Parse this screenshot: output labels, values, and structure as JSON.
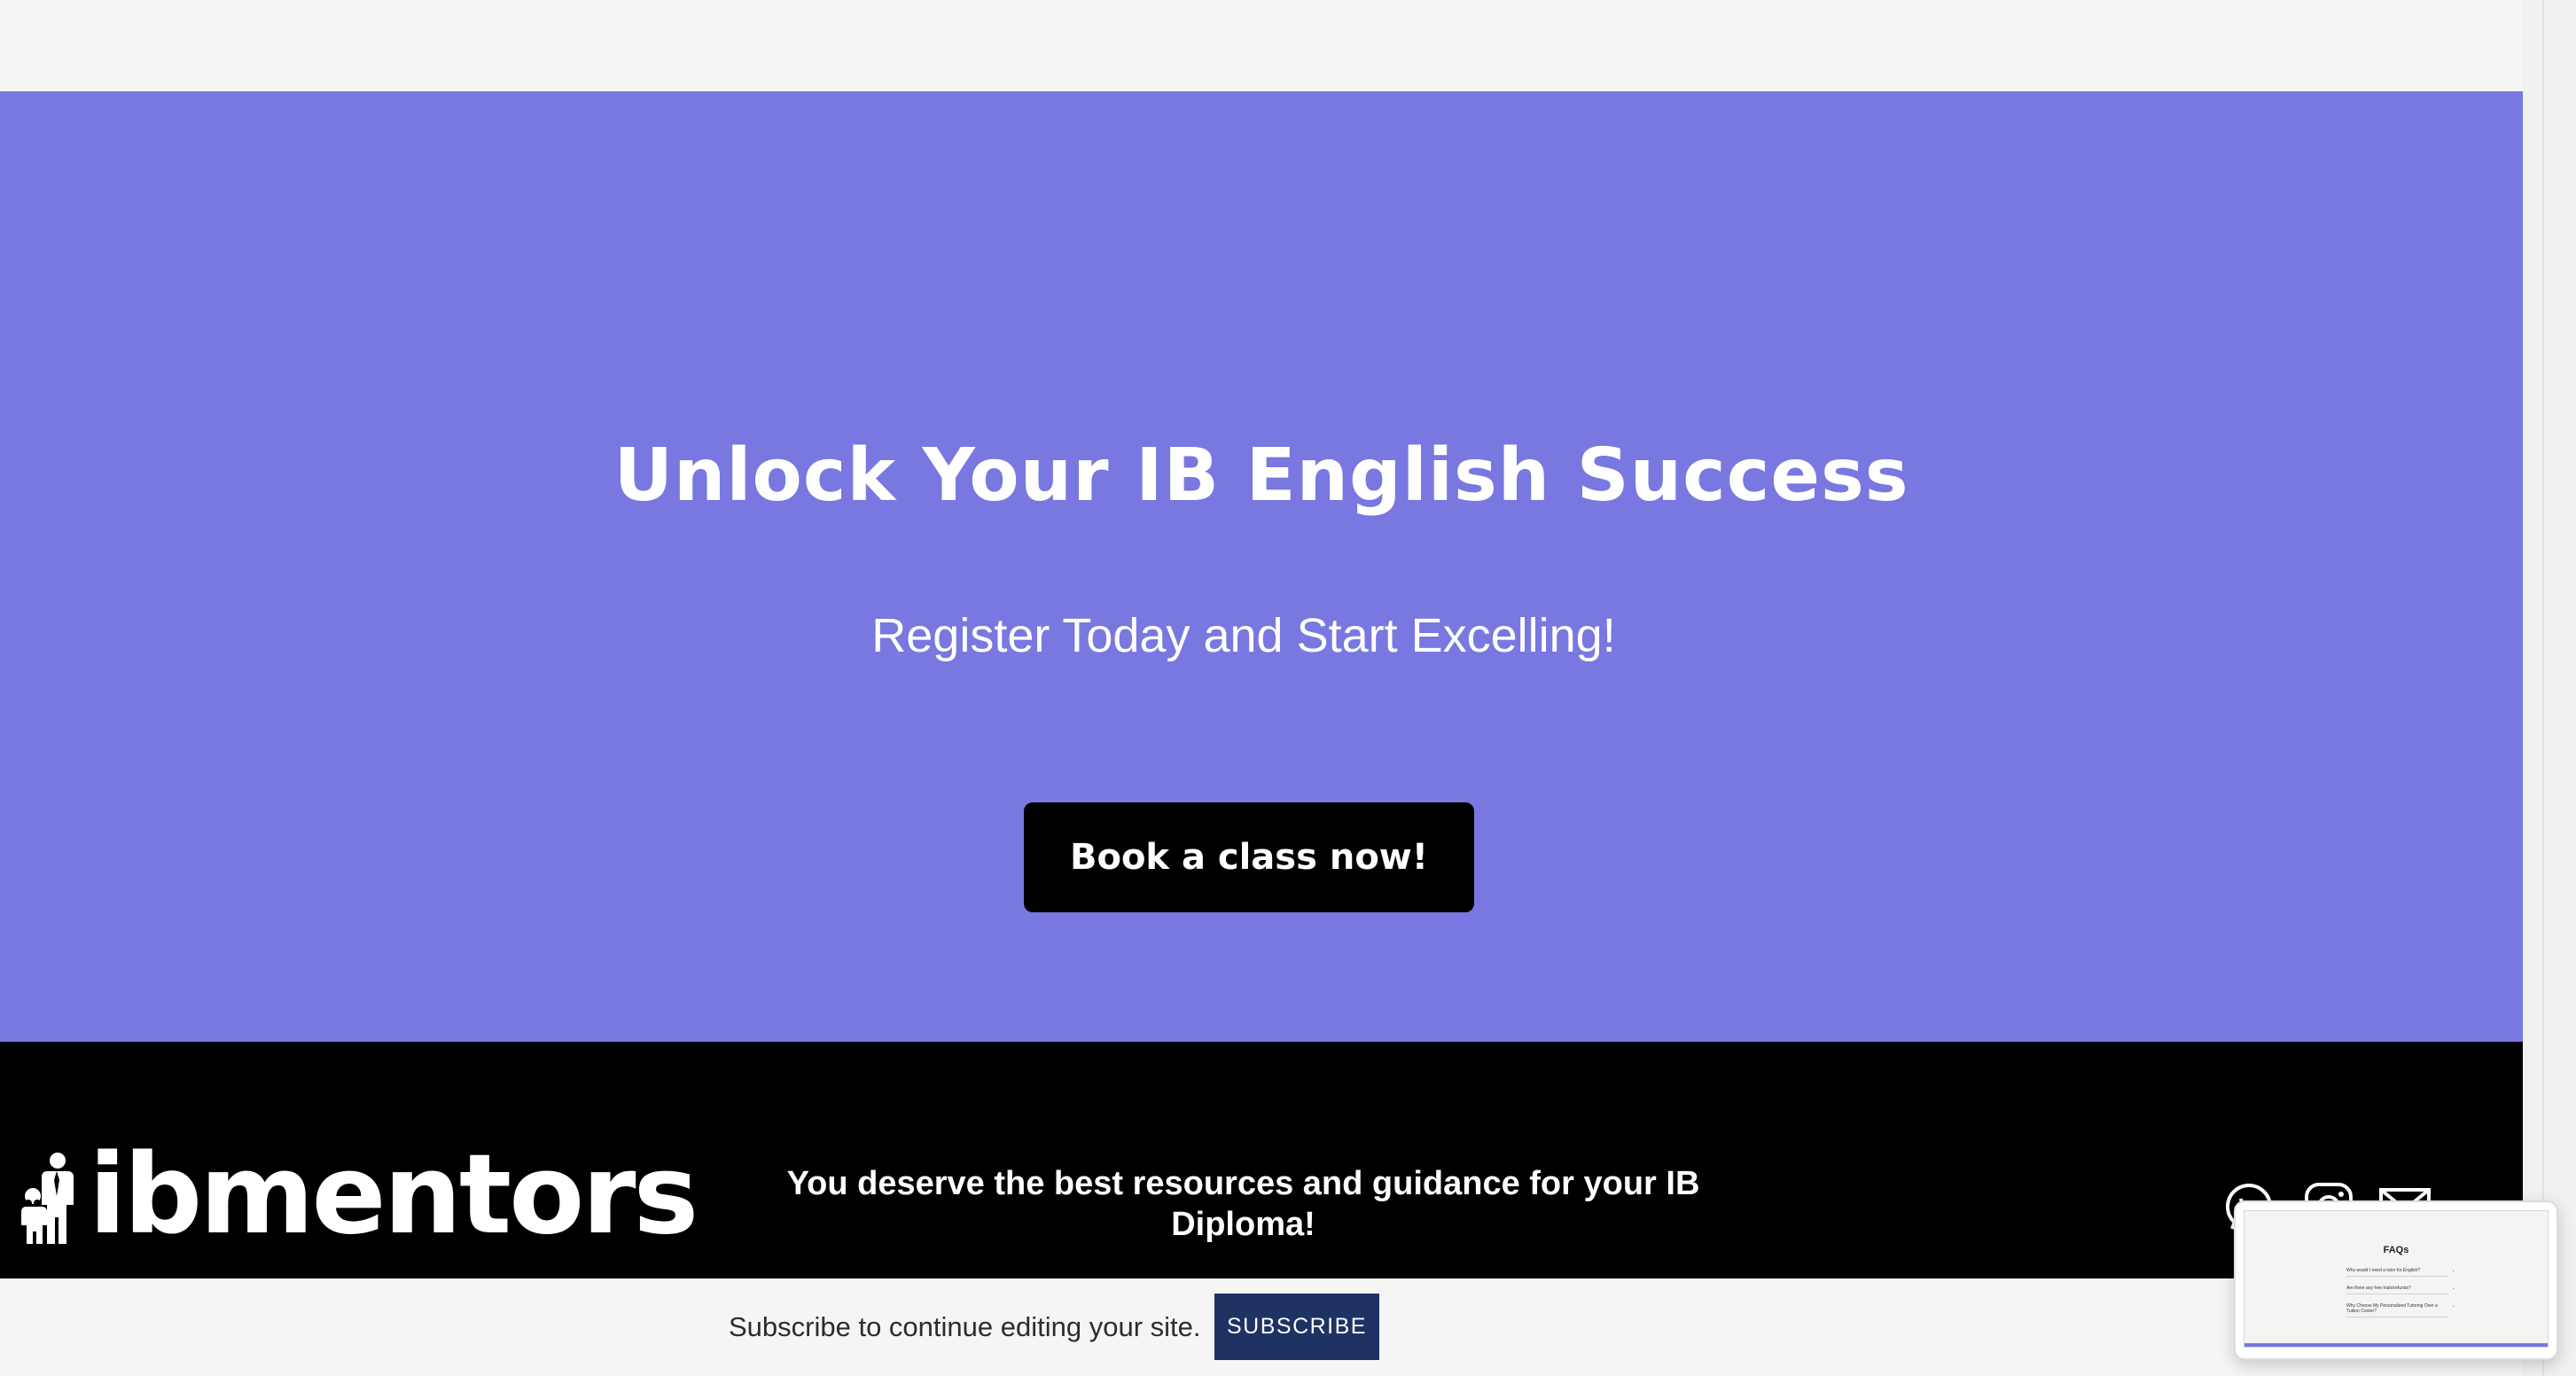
{
  "hero": {
    "title": "Unlock Your IB English Success",
    "subtitle": "Register Today and Start Excelling!",
    "cta_label": "Book a class now!",
    "background": "#7878e0"
  },
  "footer": {
    "logo_text": "ibmentors",
    "tagline": "You deserve the best resources and guidance for your IB Diploma!",
    "social_icons": [
      "whatsapp-icon",
      "instagram-icon",
      "mail-icon"
    ]
  },
  "subscribe_bar": {
    "message": "Subscribe to continue editing your site.",
    "button_label": "SUBSCRIBE",
    "button_color": "#1e3263"
  },
  "preview": {
    "title": "FAQs",
    "items": [
      "Why would I need a tutor for English?",
      "Are there any free trials/refunds?",
      "Why Choose My Personalized Tutoring Over a Tuition Center?"
    ]
  }
}
